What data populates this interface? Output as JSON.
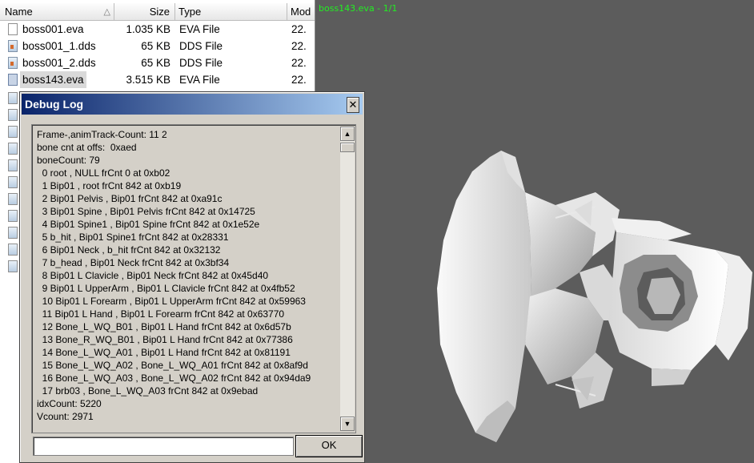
{
  "file_list": {
    "columns": {
      "name": "Name",
      "size": "Size",
      "type": "Type",
      "modified": "Mod"
    },
    "rows": [
      {
        "name": "boss001.eva",
        "size": "1.035 KB",
        "type": "EVA File",
        "modified": "22."
      },
      {
        "name": "boss001_1.dds",
        "size": "65 KB",
        "type": "DDS File",
        "modified": "22."
      },
      {
        "name": "boss001_2.dds",
        "size": "65 KB",
        "type": "DDS File",
        "modified": "22."
      },
      {
        "name": "boss143.eva",
        "size": "3.515 KB",
        "type": "EVA File",
        "modified": "22."
      }
    ]
  },
  "viewer": {
    "title": "boss143.eva - 1/1"
  },
  "dialog": {
    "title": "Debug Log",
    "close_glyph": "✕",
    "ok_label": "OK",
    "command_value": "",
    "log_lines": [
      "Frame-,animTrack-Count: 11 2",
      "bone cnt at offs:  0xaed",
      "boneCount: 79",
      "  0 root , NULL frCnt 0 at 0xb02",
      "  1 Bip01 , root frCnt 842 at 0xb19",
      "  2 Bip01 Pelvis , Bip01 frCnt 842 at 0xa91c",
      "  3 Bip01 Spine , Bip01 Pelvis frCnt 842 at 0x14725",
      "  4 Bip01 Spine1 , Bip01 Spine frCnt 842 at 0x1e52e",
      "  5 b_hit , Bip01 Spine1 frCnt 842 at 0x28331",
      "  6 Bip01 Neck , b_hit frCnt 842 at 0x32132",
      "  7 b_head , Bip01 Neck frCnt 842 at 0x3bf34",
      "  8 Bip01 L Clavicle , Bip01 Neck frCnt 842 at 0x45d40",
      "  9 Bip01 L UpperArm , Bip01 L Clavicle frCnt 842 at 0x4fb52",
      "  10 Bip01 L Forearm , Bip01 L UpperArm frCnt 842 at 0x59963",
      "  11 Bip01 L Hand , Bip01 L Forearm frCnt 842 at 0x63770",
      "  12 Bone_L_WQ_B01 , Bip01 L Hand frCnt 842 at 0x6d57b",
      "  13 Bone_R_WQ_B01 , Bip01 L Hand frCnt 842 at 0x77386",
      "  14 Bone_L_WQ_A01 , Bip01 L Hand frCnt 842 at 0x81191",
      "  15 Bone_L_WQ_A02 , Bone_L_WQ_A01 frCnt 842 at 0x8af9d",
      "  16 Bone_L_WQ_A03 , Bone_L_WQ_A02 frCnt 842 at 0x94da9",
      "  17 brb03 , Bone_L_WQ_A03 frCnt 842 at 0x9ebad",
      "idxCount: 5220",
      "Vcount: 2971"
    ]
  },
  "colors": {
    "viewer_bg": "#5c5c5c",
    "viewer_title": "#22ee22",
    "dialog_title_from": "#0a246a",
    "dialog_title_to": "#a6caf0"
  },
  "icons": {
    "eva": "document-icon",
    "dds": "image-file-icon",
    "sort": "sort-arrow-icon",
    "scroll_up": "arrow-up-icon",
    "scroll_down": "arrow-down-icon"
  }
}
